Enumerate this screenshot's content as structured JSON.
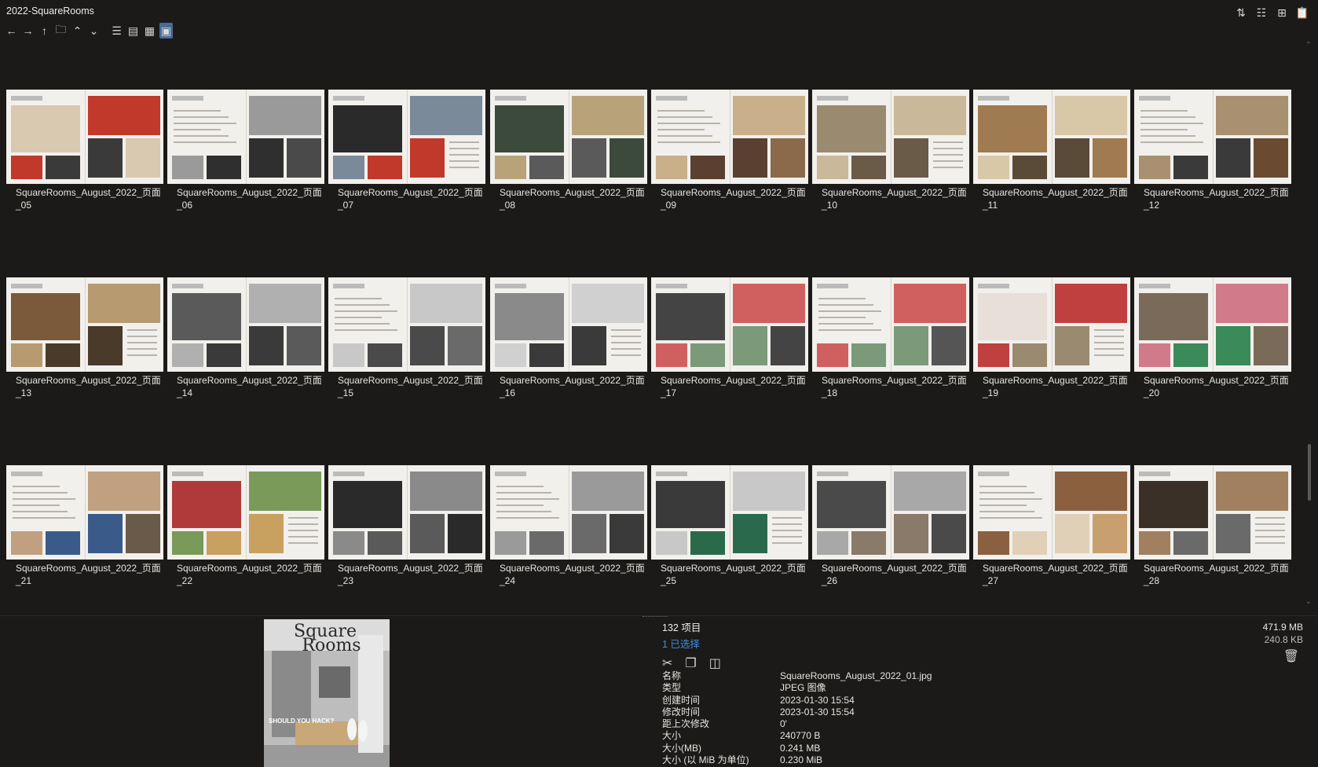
{
  "window": {
    "title": "2022-SquareRooms"
  },
  "toolbar": {
    "left": [
      {
        "name": "back-arrow-icon",
        "glyph": "←"
      },
      {
        "name": "forward-arrow-icon",
        "glyph": "→"
      },
      {
        "name": "up-arrow-icon",
        "glyph": "↑"
      },
      {
        "name": "folder-open-icon",
        "glyph": "🗀"
      },
      {
        "name": "chevron-up-icon",
        "glyph": "⌃"
      },
      {
        "name": "chevron-down-icon",
        "glyph": "⌄"
      }
    ],
    "views": [
      {
        "name": "list-view-icon",
        "glyph": "☰"
      },
      {
        "name": "details-view-icon",
        "glyph": "▤"
      },
      {
        "name": "tiles-view-icon",
        "glyph": "▦"
      },
      {
        "name": "thumbnail-view-icon",
        "glyph": "▣",
        "active": true
      }
    ],
    "right": [
      {
        "name": "sort-icon",
        "glyph": "⇅"
      },
      {
        "name": "tree-view-icon",
        "glyph": "☷"
      },
      {
        "name": "new-tab-icon",
        "glyph": "⊞"
      },
      {
        "name": "clipboard-icon",
        "glyph": "📋"
      }
    ]
  },
  "files": [
    "SquareRooms_August_2022_页面_05",
    "SquareRooms_August_2022_页面_06",
    "SquareRooms_August_2022_页面_07",
    "SquareRooms_August_2022_页面_08",
    "SquareRooms_August_2022_页面_09",
    "SquareRooms_August_2022_页面_10",
    "SquareRooms_August_2022_页面_11",
    "SquareRooms_August_2022_页面_12",
    "SquareRooms_August_2022_页面_13",
    "SquareRooms_August_2022_页面_14",
    "SquareRooms_August_2022_页面_15",
    "SquareRooms_August_2022_页面_16",
    "SquareRooms_August_2022_页面_17",
    "SquareRooms_August_2022_页面_18",
    "SquareRooms_August_2022_页面_19",
    "SquareRooms_August_2022_页面_20",
    "SquareRooms_August_2022_页面_21",
    "SquareRooms_August_2022_页面_22",
    "SquareRooms_August_2022_页面_23",
    "SquareRooms_August_2022_页面_24",
    "SquareRooms_August_2022_页面_25",
    "SquareRooms_August_2022_页面_26",
    "SquareRooms_August_2022_页面_27",
    "SquareRooms_August_2022_页面_28"
  ],
  "thumb_palettes": [
    [
      "#d8c9b0",
      "#c0392b",
      "#3a3a3a"
    ],
    [
      "#4a4a4a",
      "#9a9a9a",
      "#2f2f2f"
    ],
    [
      "#2a2a2a",
      "#7a8a9a",
      "#c0392b"
    ],
    [
      "#3b4a3a",
      "#b8a27a",
      "#5a5a5a"
    ],
    [
      "#8a6a4a",
      "#c9b08a",
      "#5a4030"
    ],
    [
      "#9a8a70",
      "#c9b89a",
      "#6a5a48"
    ],
    [
      "#a07a50",
      "#d8c8a8",
      "#5a4a38"
    ],
    [
      "#6a4a30",
      "#a89070",
      "#3a3a3a"
    ],
    [
      "#7a5a3a",
      "#b89a70",
      "#4a3a2a"
    ],
    [
      "#5a5a5a",
      "#b0b0b0",
      "#3a3a3a"
    ],
    [
      "#6a6a6a",
      "#c8c8c8",
      "#4a4a4a"
    ],
    [
      "#8a8a8a",
      "#d0d0d0",
      "#3a3a3a"
    ],
    [
      "#444",
      "#d06060",
      "#7a9a7a"
    ],
    [
      "#555",
      "#d06060",
      "#7a9a7a"
    ],
    [
      "#e8e0d8",
      "#c04040",
      "#9a8a70"
    ],
    [
      "#7a6a5a",
      "#d07a8a",
      "#3a8a5a"
    ],
    [
      "#6a5a4a",
      "#c0a080",
      "#3a5a8a"
    ],
    [
      "#b03a3a",
      "#7a9a5a",
      "#c8a060"
    ],
    [
      "#2a2a2a",
      "#8a8a8a",
      "#5a5a5a"
    ],
    [
      "#3a3a3a",
      "#9a9a9a",
      "#6a6a6a"
    ],
    [
      "#3a3a3a",
      "#c8c8c8",
      "#2a6a4a"
    ],
    [
      "#4a4a4a",
      "#a8a8a8",
      "#8a7a6a"
    ],
    [
      "#c8a070",
      "#8a6040",
      "#e0d0b8"
    ],
    [
      "#3a3028",
      "#a08060",
      "#6a6a6a"
    ]
  ],
  "status": {
    "item_count": "132 项目",
    "selected": "1 已选择",
    "total_size": "471.9 MB",
    "selected_size": "240.8 KB"
  },
  "preview": {
    "title_line1": "Square",
    "title_line2": "Rooms",
    "cover_headline": "SHOULD YOU HACK?"
  },
  "properties": [
    {
      "key": "名称",
      "value": "SquareRooms_August_2022_01.jpg"
    },
    {
      "key": "类型",
      "value": "JPEG 图像"
    },
    {
      "key": "创建时间",
      "value": "2023-01-30  15:54"
    },
    {
      "key": "修改时间",
      "value": "2023-01-30  15:54"
    },
    {
      "key": "距上次修改",
      "value": "0'"
    },
    {
      "key": "大小",
      "value": "240770 B"
    },
    {
      "key": "大小(MB)",
      "value": "0.241 MB"
    },
    {
      "key": "大小 (以 MiB 为单位)",
      "value": "0.230 MiB"
    }
  ],
  "actions": [
    {
      "name": "cut-icon",
      "glyph": "✂"
    },
    {
      "name": "copy-icon",
      "glyph": "❐"
    },
    {
      "name": "compare-icon",
      "glyph": "◫"
    }
  ]
}
